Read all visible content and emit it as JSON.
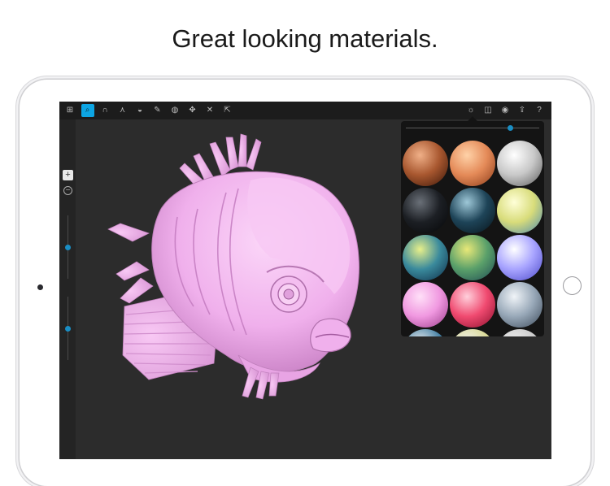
{
  "headline": "Great looking materials.",
  "toolbar": {
    "left_tools": [
      {
        "name": "grid-menu-icon",
        "glyph": "⊞",
        "active": false
      },
      {
        "name": "search-tool-icon",
        "glyph": "⌕",
        "active": true
      },
      {
        "name": "magnet-tool-icon",
        "glyph": "∩",
        "active": false
      },
      {
        "name": "pinch-tool-icon",
        "glyph": "⋏",
        "active": false
      },
      {
        "name": "flatten-tool-icon",
        "glyph": "◒",
        "active": false
      },
      {
        "name": "brush-tool-icon",
        "glyph": "✎",
        "active": false
      },
      {
        "name": "sphere-tool-icon",
        "glyph": "◍",
        "active": false
      },
      {
        "name": "move-tool-icon",
        "glyph": "✥",
        "active": false
      },
      {
        "name": "transform-tool-icon",
        "glyph": "✕",
        "active": false
      },
      {
        "name": "scale-tool-icon",
        "glyph": "⇱",
        "active": false
      }
    ],
    "right_tools": [
      {
        "name": "light-settings-icon",
        "glyph": "☼"
      },
      {
        "name": "symmetry-icon",
        "glyph": "◫"
      },
      {
        "name": "view-eye-icon",
        "glyph": "◉"
      },
      {
        "name": "share-icon",
        "glyph": "⇪"
      },
      {
        "name": "help-icon",
        "glyph": "?"
      }
    ]
  },
  "sidebar": {
    "zoom_in_glyph": "+",
    "zoom_out_glyph": "−",
    "sliders": [
      {
        "name": "brush-radius-slider",
        "value": 0.5
      },
      {
        "name": "brush-intensity-slider",
        "value": 0.5
      }
    ]
  },
  "materials_panel": {
    "slider_value": 0.78,
    "materials": [
      {
        "name": "copper",
        "colors": [
          "#f0b088",
          "#a8572f",
          "#3a1608"
        ]
      },
      {
        "name": "peach",
        "colors": [
          "#ffd2a8",
          "#e48a58",
          "#8a3a18"
        ]
      },
      {
        "name": "white",
        "colors": [
          "#ffffff",
          "#c8c8c8",
          "#5a5a5a"
        ]
      },
      {
        "name": "black-gloss",
        "colors": [
          "#6a7078",
          "#1c1f24",
          "#050607"
        ]
      },
      {
        "name": "blue-marble",
        "colors": [
          "#9ec8d8",
          "#1e4458",
          "#071218"
        ]
      },
      {
        "name": "pastel-yellow",
        "colors": [
          "#ffffd8",
          "#d8dc7a",
          "#4c8ab0"
        ]
      },
      {
        "name": "teal-yellow",
        "colors": [
          "#e8f08a",
          "#3a8a9c",
          "#0e2c48"
        ]
      },
      {
        "name": "green-yellow",
        "colors": [
          "#e8e878",
          "#5aa06a",
          "#1e4a54"
        ]
      },
      {
        "name": "lavender",
        "colors": [
          "#ffffff",
          "#a8a4ff",
          "#4a48c8"
        ]
      },
      {
        "name": "pink",
        "colors": [
          "#ffe0f8",
          "#f098e0",
          "#9a3a8a"
        ]
      },
      {
        "name": "red-pink",
        "colors": [
          "#ffd0dc",
          "#f04a70",
          "#8a0e2c"
        ]
      },
      {
        "name": "silver-blue",
        "colors": [
          "#f0f4f8",
          "#98a8b8",
          "#3a4858"
        ]
      }
    ]
  },
  "model": {
    "name": "fish-sculpt",
    "color": "#f4b4f0"
  }
}
